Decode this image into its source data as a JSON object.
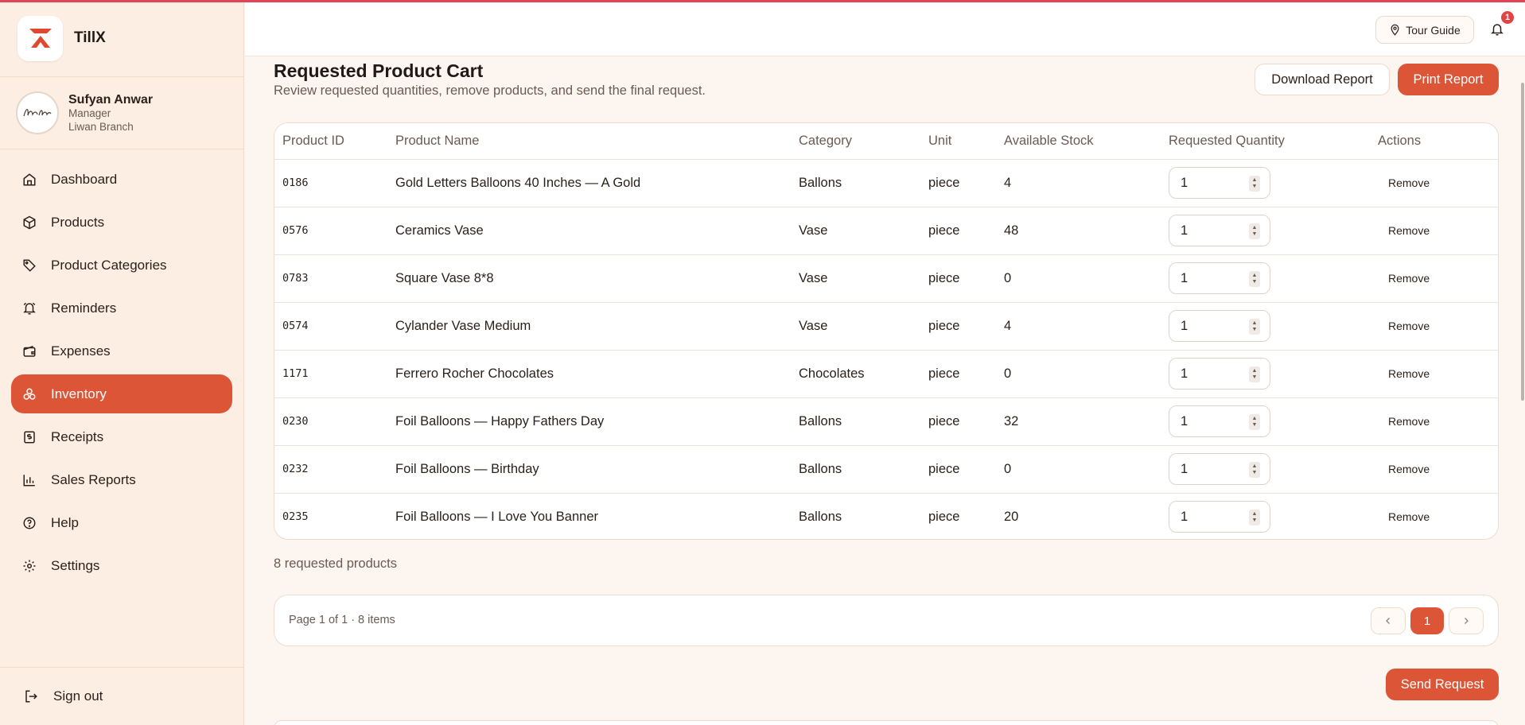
{
  "app": {
    "name": "TillX"
  },
  "user": {
    "name": "Sufyan Anwar",
    "role": "Manager",
    "branch": "Liwan Branch"
  },
  "sidebar": {
    "items": [
      {
        "label": "Dashboard",
        "icon": "home-icon"
      },
      {
        "label": "Products",
        "icon": "box-icon"
      },
      {
        "label": "Product Categories",
        "icon": "tag-icon"
      },
      {
        "label": "Reminders",
        "icon": "alarm-icon"
      },
      {
        "label": "Expenses",
        "icon": "wallet-icon"
      },
      {
        "label": "Inventory",
        "icon": "layers-icon",
        "active": true
      },
      {
        "label": "Receipts",
        "icon": "receipt-icon"
      },
      {
        "label": "Sales Reports",
        "icon": "bar-chart-icon"
      },
      {
        "label": "Help",
        "icon": "help-circle-icon"
      },
      {
        "label": "Settings",
        "icon": "gear-icon"
      }
    ],
    "signout": "Sign out"
  },
  "topbar": {
    "tour_guide": "Tour Guide",
    "notification_count": "1"
  },
  "page": {
    "title": "Requested Product Cart",
    "subtitle": "Review requested quantities, remove products, and send the final request.",
    "download_label": "Download Report",
    "print_label": "Print Report"
  },
  "table": {
    "headers": {
      "id": "Product ID",
      "name": "Product Name",
      "category": "Category",
      "unit": "Unit",
      "stock": "Available Stock",
      "qty": "Requested Quantity",
      "actions": "Actions"
    },
    "remove_label": "Remove",
    "rows": [
      {
        "id": "0186",
        "name": "Gold Letters Balloons 40 Inches — A Gold",
        "category": "Ballons",
        "unit": "piece",
        "stock": "4",
        "qty": "1"
      },
      {
        "id": "0576",
        "name": "Ceramics Vase",
        "category": "Vase",
        "unit": "piece",
        "stock": "48",
        "qty": "1"
      },
      {
        "id": "0783",
        "name": "Square Vase 8*8",
        "category": "Vase",
        "unit": "piece",
        "stock": "0",
        "qty": "1"
      },
      {
        "id": "0574",
        "name": "Cylander Vase Medium",
        "category": "Vase",
        "unit": "piece",
        "stock": "4",
        "qty": "1"
      },
      {
        "id": "1171",
        "name": "Ferrero Rocher Chocolates",
        "category": "Chocolates",
        "unit": "piece",
        "stock": "0",
        "qty": "1"
      },
      {
        "id": "0230",
        "name": "Foil Balloons — Happy Fathers Day",
        "category": "Ballons",
        "unit": "piece",
        "stock": "32",
        "qty": "1"
      },
      {
        "id": "0232",
        "name": "Foil Balloons — Birthday",
        "category": "Ballons",
        "unit": "piece",
        "stock": "0",
        "qty": "1"
      },
      {
        "id": "0235",
        "name": "Foil Balloons — I Love You Banner",
        "category": "Ballons",
        "unit": "piece",
        "stock": "20",
        "qty": "1"
      }
    ]
  },
  "summary": {
    "count_text": "8 requested products"
  },
  "pagination": {
    "text": "Page 1 of 1 · 8 items",
    "current": "1"
  },
  "actions": {
    "send_label": "Send Request"
  },
  "colors": {
    "accent": "#dd5537",
    "sidebar_bg": "#fdeee3",
    "page_bg": "#fdf5ef"
  }
}
